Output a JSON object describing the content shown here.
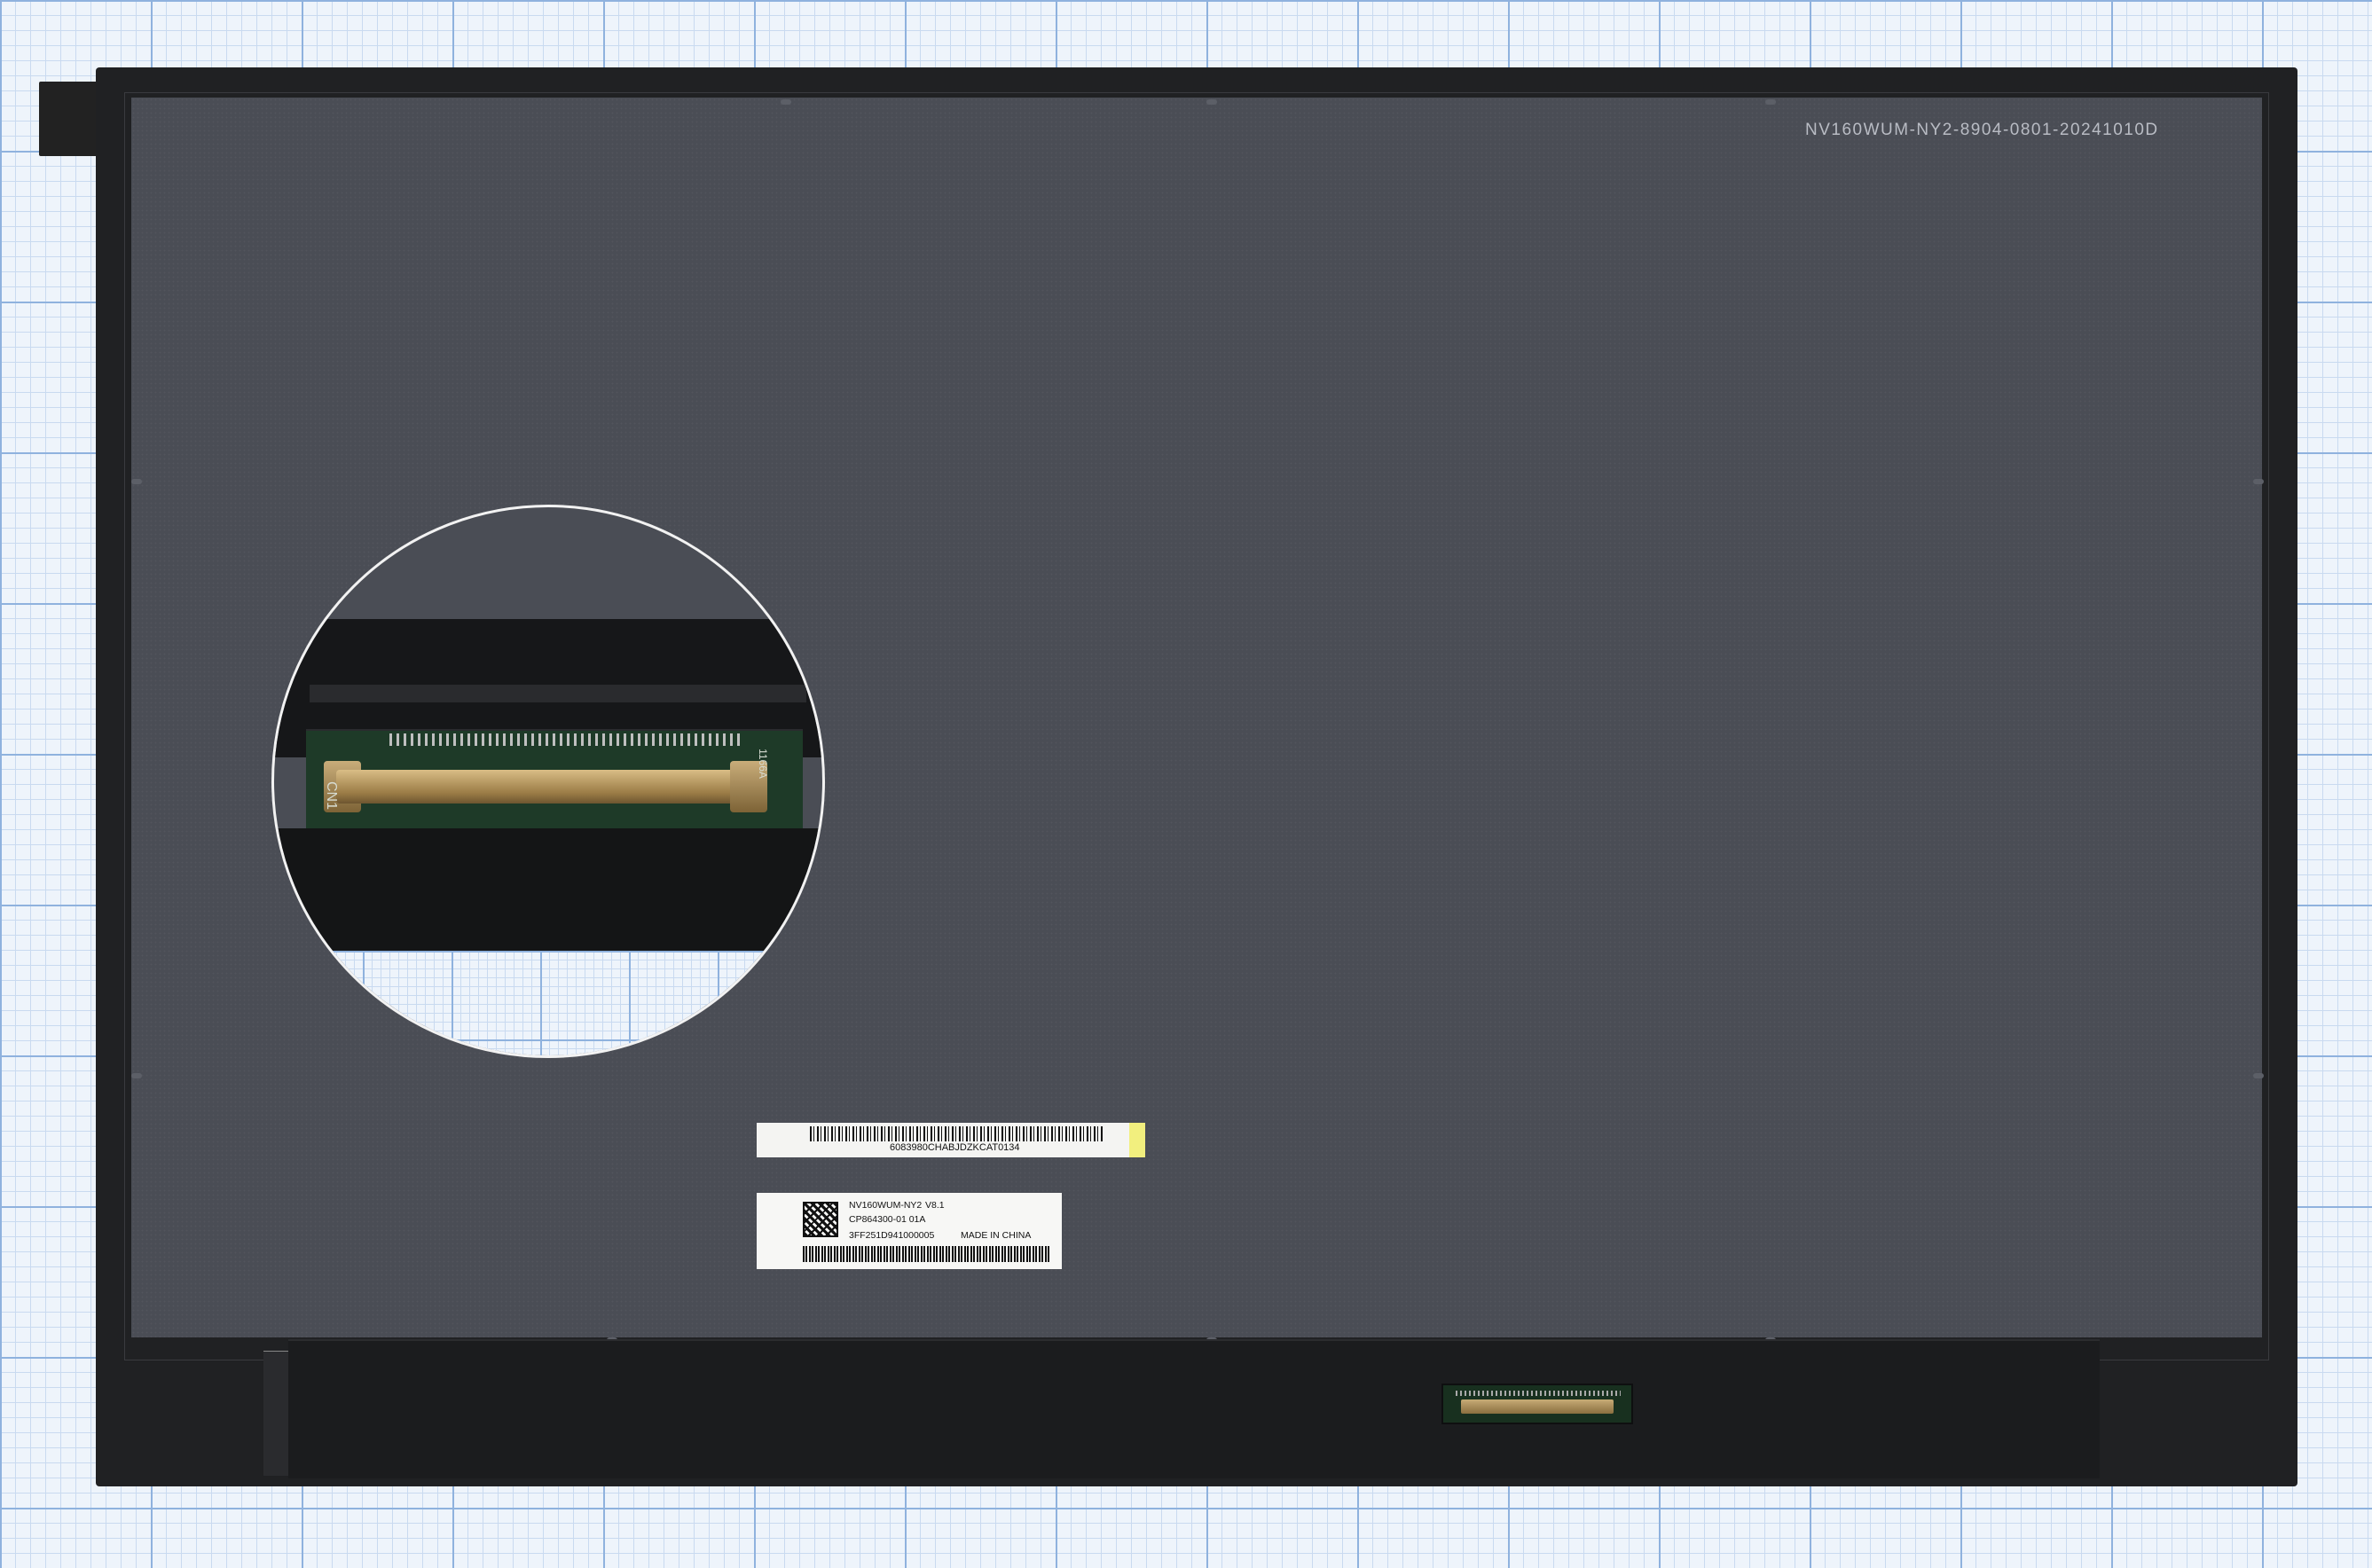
{
  "panel": {
    "model_print": "NV160WUM-NY2-8904-0801-20241010D"
  },
  "barcode_sticker": {
    "code": "6083980CHABJDZKCAT0134"
  },
  "product_label": {
    "model": "NV160WUM-NY2",
    "version": "V8.1",
    "part_number": "CP864300-01 01A",
    "serial": "3FF251D941000005",
    "origin": "MADE IN CHINA"
  },
  "zoom_inset": {
    "pcb_label_cn": "CN1",
    "pcb_label_side": "1166A"
  }
}
